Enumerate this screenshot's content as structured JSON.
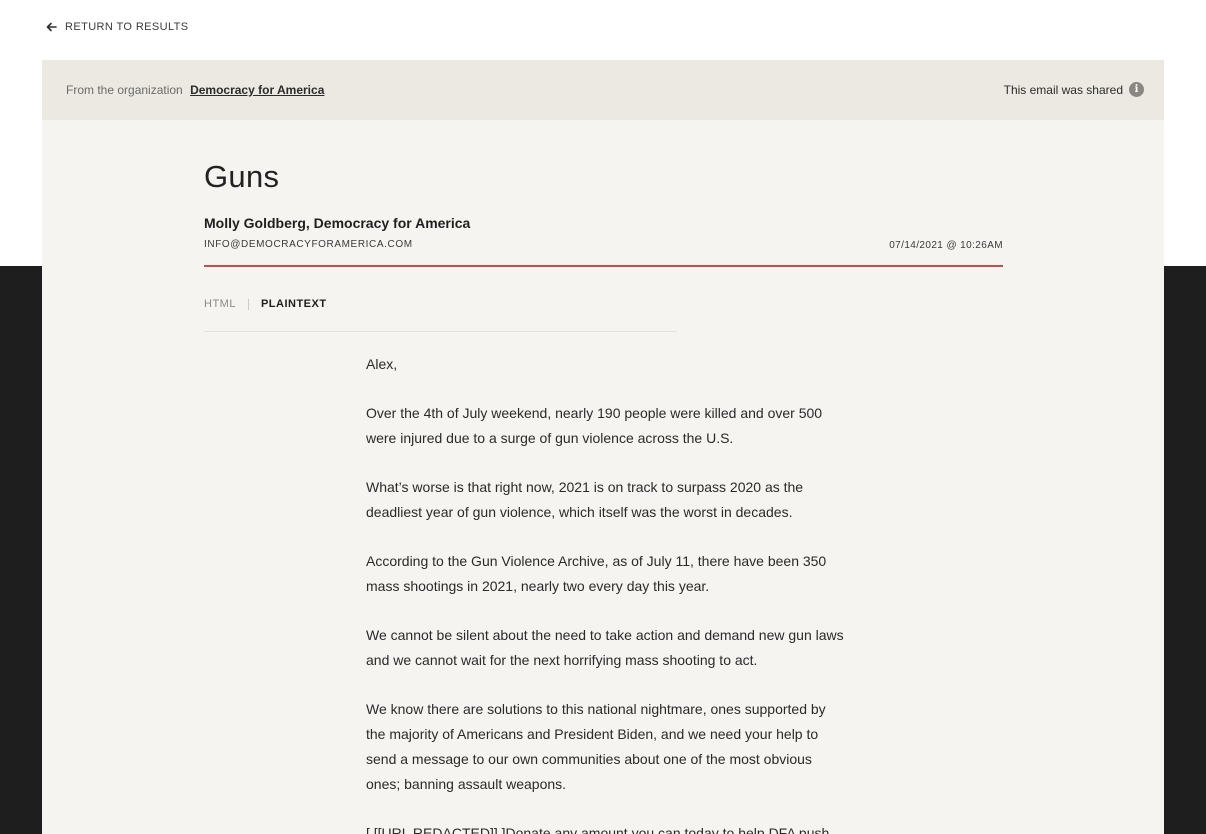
{
  "nav": {
    "return_label": "RETURN TO RESULTS"
  },
  "org_bar": {
    "prefix": "From the organization",
    "org_name": "Democracy for America",
    "shared_label": "This email was shared",
    "info_icon": "info-icon"
  },
  "email": {
    "subject": "Guns",
    "sender_name": "Molly Goldberg, Democracy for America",
    "sender_email": "INFO@DEMOCRACYFORAMERICA.COM",
    "timestamp": "07/14/2021 @ 10:26AM"
  },
  "tabs": [
    {
      "label": "HTML",
      "active": false
    },
    {
      "label": "PLAINTEXT",
      "active": true
    }
  ],
  "body": {
    "paragraphs": [
      "Alex,",
      "Over the 4th of July weekend, nearly 190 people were killed and over 500 were injured due to a surge of gun violence across the U.S.",
      "What’s worse is that right now, 2021 is on track to surpass 2020 as the deadliest year of gun violence, which itself was the worst in decades.",
      "According to the Gun Violence Archive, as of July 11, there have been 350 mass shootings in 2021, nearly two every day this year.",
      "We cannot be silent about the need to take action and demand new gun laws and we cannot wait for the next horrifying mass shooting to act.",
      "We know there are solutions to this national nightmare, ones supported by the majority of Americans and President Biden, and we need your help to send a message to our own communities about one of the most obvious ones; banning assault weapons.",
      "[ [[URL REDACTED]] ]Donate any amount you can today to help DFA push"
    ]
  },
  "colors": {
    "accent_rule": "#c0504d",
    "card_background": "#f6f4f0",
    "org_bar_background": "#ece9e2",
    "dark_band": "#1f1e1e"
  }
}
